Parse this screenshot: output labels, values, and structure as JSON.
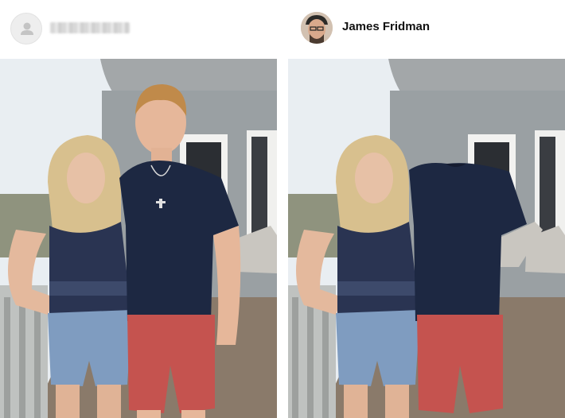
{
  "left_post": {
    "username_blurred": true,
    "avatar_icon": "default-user-icon"
  },
  "right_post": {
    "username": "James Fridman",
    "avatar_icon": "profile-photo"
  },
  "colors": {
    "shirt": "#1d2842",
    "shorts": "#c5534f",
    "denim": "#7f9cc0",
    "tank": "#2a3452",
    "deck": "#8a7a6a",
    "sky": "#e9eef2"
  }
}
